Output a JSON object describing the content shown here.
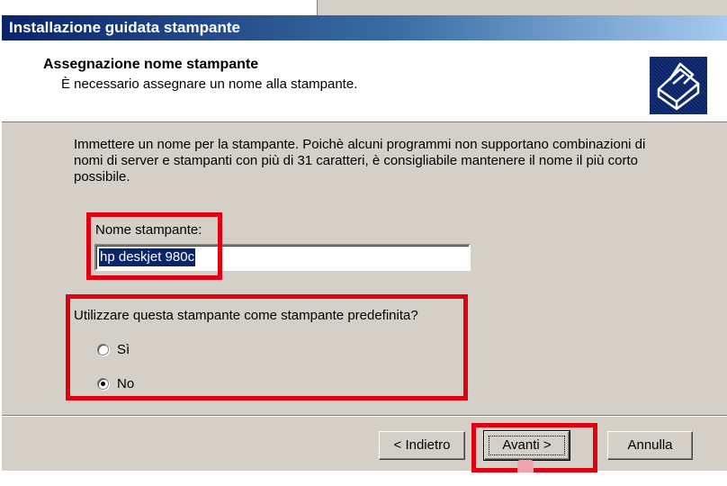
{
  "window": {
    "title": "Installazione guidata stampante"
  },
  "header": {
    "title": "Assegnazione nome stampante",
    "subtitle": "È necessario assegnare un nome alla stampante.",
    "icon": "printer-icon"
  },
  "body": {
    "intro": "Immettere un nome per la stampante. Poichè alcuni programmi non supportano combinazioni di nomi di server e stampanti con più di 31 caratteri, è consigliabile mantenere il nome il più corto possibile.",
    "name_label": "Nome stampante:",
    "name_value": "hp deskjet 980c",
    "default_question": "Utilizzare questa stampante come stampante predefinita?",
    "options": [
      {
        "label": "Sì",
        "checked": false
      },
      {
        "label": "No",
        "checked": true
      }
    ]
  },
  "buttons": {
    "back": "< Indietro",
    "next": "Avanti >",
    "cancel": "Annulla"
  },
  "colors": {
    "dialog_bg": "#d4d0c8",
    "title_start": "#0a246a",
    "highlight": "#e0000f"
  }
}
